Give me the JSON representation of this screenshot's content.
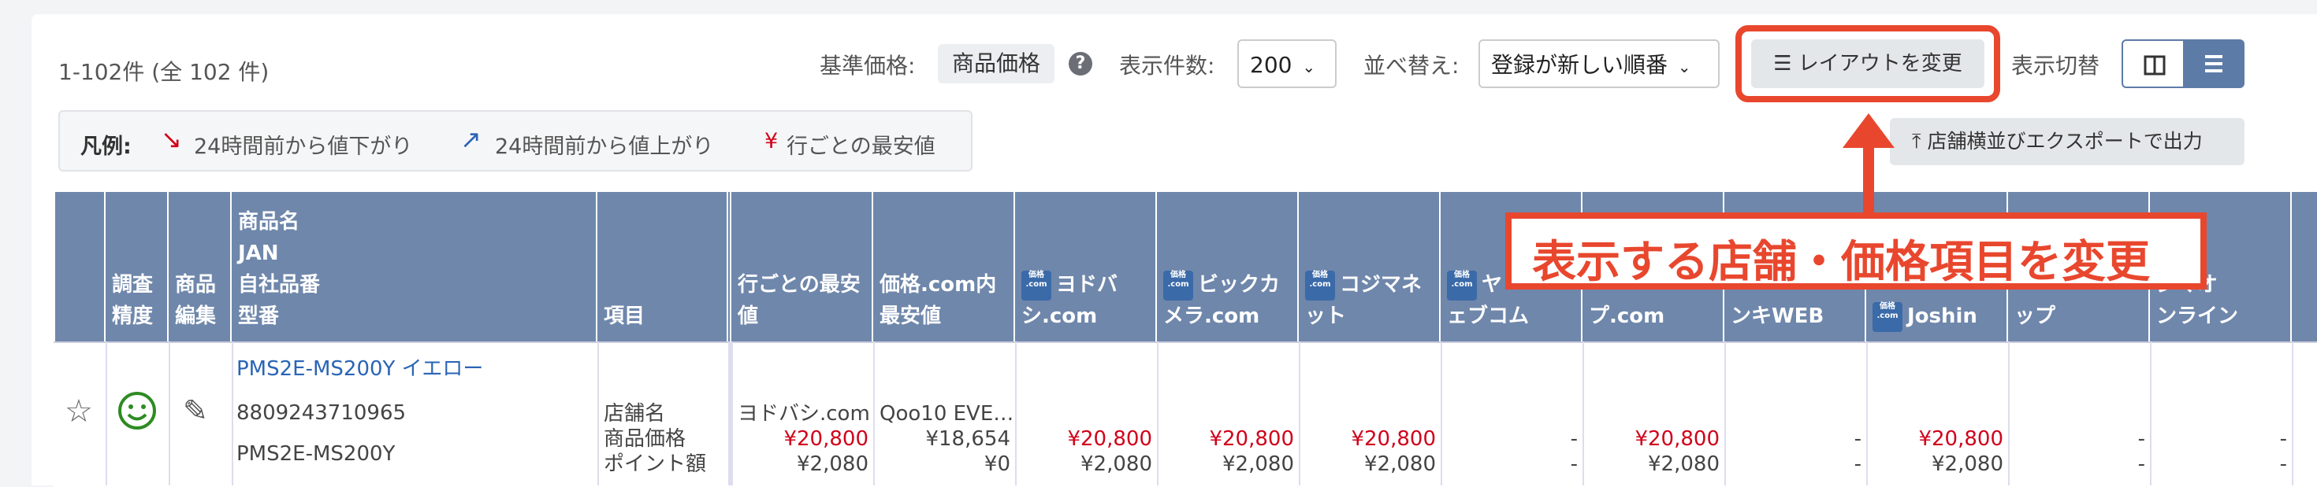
{
  "toolbar": {
    "count_text": "1-102件 (全 102 件)",
    "base_price_label": "基準価格:",
    "base_price_value": "商品価格",
    "per_page_label": "表示件数:",
    "per_page_value": "200",
    "sort_label": "並べ替え:",
    "sort_value": "登録が新しい順番",
    "layout_button": "レイアウトを変更",
    "view_toggle_label": "表示切替",
    "export_button": "店舗横並びエクスポートで出力"
  },
  "legend": {
    "title": "凡例:",
    "down": "24時間前から値下がり",
    "up": "24時間前から値上がり",
    "lowest_mark": "¥",
    "lowest": "行ごとの最安値"
  },
  "callout": {
    "text": "表示する店舗・価格項目を変更"
  },
  "table": {
    "headers": {
      "survey_accuracy": [
        "調査",
        "精度"
      ],
      "product_edit": [
        "商品",
        "編集"
      ],
      "product_info": [
        "商品名",
        "JAN",
        "自社品番",
        "型番"
      ],
      "item": "項目",
      "row_lowest": [
        "行ごとの最安",
        "値"
      ],
      "kakaku_lowest": [
        "価格.com内",
        "最安値"
      ],
      "stores": [
        [
          "ヨドバ",
          "シ.com"
        ],
        [
          "ビックカ",
          "メラ.com"
        ],
        [
          "コジマネ",
          "ット"
        ],
        [
          "ヤ",
          "ェブコム"
        ],
        [
          "",
          "プ.com"
        ],
        [
          "",
          "ンキWEB"
        ],
        [
          "",
          "Joshin"
        ],
        [
          "",
          "ップ"
        ],
        [
          "ジマオ",
          "ンライン"
        ]
      ]
    },
    "row": {
      "product_name": "PMS2E-MS200Y イエロー",
      "jan": "8809243710965",
      "model": "PMS2E-MS200Y",
      "item_labels": [
        "店舗名",
        "商品価格",
        "ポイント額"
      ],
      "row_lowest": {
        "store": "ヨドバシ.com",
        "price": "¥20,800",
        "points": "¥2,080"
      },
      "kakaku_lowest": {
        "store": "Qoo10 EVE…",
        "price": "¥18,654",
        "points": "¥0"
      },
      "stores": [
        {
          "price": "¥20,800",
          "points": "¥2,080"
        },
        {
          "price": "¥20,800",
          "points": "¥2,080"
        },
        {
          "price": "¥20,800",
          "points": "¥2,080"
        },
        {
          "price": "-",
          "points": "-"
        },
        {
          "price": "¥20,800",
          "points": "¥2,080"
        },
        {
          "price": "-",
          "points": "-"
        },
        {
          "price": "¥20,800",
          "points": "¥2,080"
        },
        {
          "price": "-",
          "points": "-"
        },
        {
          "price": "-",
          "points": "-"
        }
      ]
    }
  },
  "colors": {
    "header_bg": "#6f87ab",
    "accent_red": "#e8472e",
    "price_red": "#d0021b",
    "link_blue": "#2a64b6",
    "smiley_green": "#2e8b22"
  }
}
